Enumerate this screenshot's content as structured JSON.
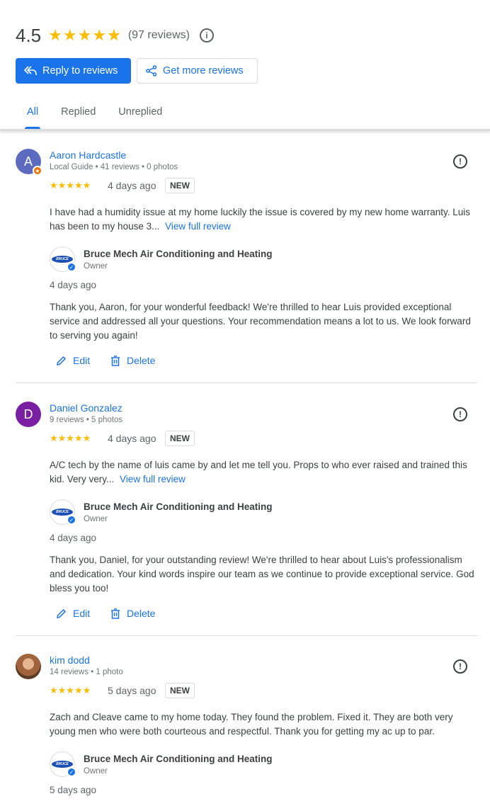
{
  "summary": {
    "rating": "4.5",
    "stars": 4.5,
    "review_count": "(97 reviews)"
  },
  "actions": {
    "reply_label": "Reply to reviews",
    "get_more_label": "Get more reviews"
  },
  "tabs": [
    {
      "label": "All",
      "active": true
    },
    {
      "label": "Replied",
      "active": false
    },
    {
      "label": "Unreplied",
      "active": false
    }
  ],
  "owner": {
    "name": "Bruce Mech Air Conditioning and Heating",
    "role": "Owner"
  },
  "review_actions": {
    "edit_label": "Edit",
    "delete_label": "Delete"
  },
  "reviews": [
    {
      "name": "Aaron Hardcastle",
      "initial": "A",
      "avatar_color": "#5c6bc0",
      "meta": "Local Guide • 41 reviews • 0 photos",
      "stars": 5,
      "date": "4 days ago",
      "badge": "NEW",
      "text": "I have had a humidity issue at my home luckily the issue is covered by my new home warranty. Luis has been to my house 3...",
      "view_full": "View full review",
      "reply_date": "4 days ago",
      "reply_text": "Thank you, Aaron, for your wonderful feedback! We're thrilled to hear Luis provided exceptional service and addressed all your questions. Your recommendation means a lot to us. We look forward to serving you again!"
    },
    {
      "name": "Daniel Gonzalez",
      "initial": "D",
      "avatar_color": "#7b1fa2",
      "meta": "9 reviews • 5 photos",
      "stars": 5,
      "date": "4 days ago",
      "badge": "NEW",
      "text": "A/C tech by the name of luis came by and let me tell you. Props to who ever raised and trained this kid. Very very...",
      "view_full": "View full review",
      "reply_date": "4 days ago",
      "reply_text": "Thank you, Daniel, for your outstanding review! We're thrilled to hear about Luis's professionalism and dedication. Your kind words inspire our team as we continue to provide exceptional service. God bless you too!"
    },
    {
      "name": "kim dodd",
      "initial": "",
      "avatar_color": "#a0643c",
      "meta": "14 reviews • 1 photo",
      "stars": 5,
      "date": "5 days ago",
      "badge": "NEW",
      "text": "Zach and Cleave came to my home today. They found the problem. Fixed it. They are both very young men who were both courteous and respectful. Thank you for getting my ac up to par.",
      "view_full": "",
      "reply_date": "5 days ago",
      "reply_text": ""
    }
  ],
  "colors": {
    "accent": "#1a73e8",
    "star": "#fbbc04",
    "text": "#3c4043",
    "secondary_text": "#5f6368"
  }
}
